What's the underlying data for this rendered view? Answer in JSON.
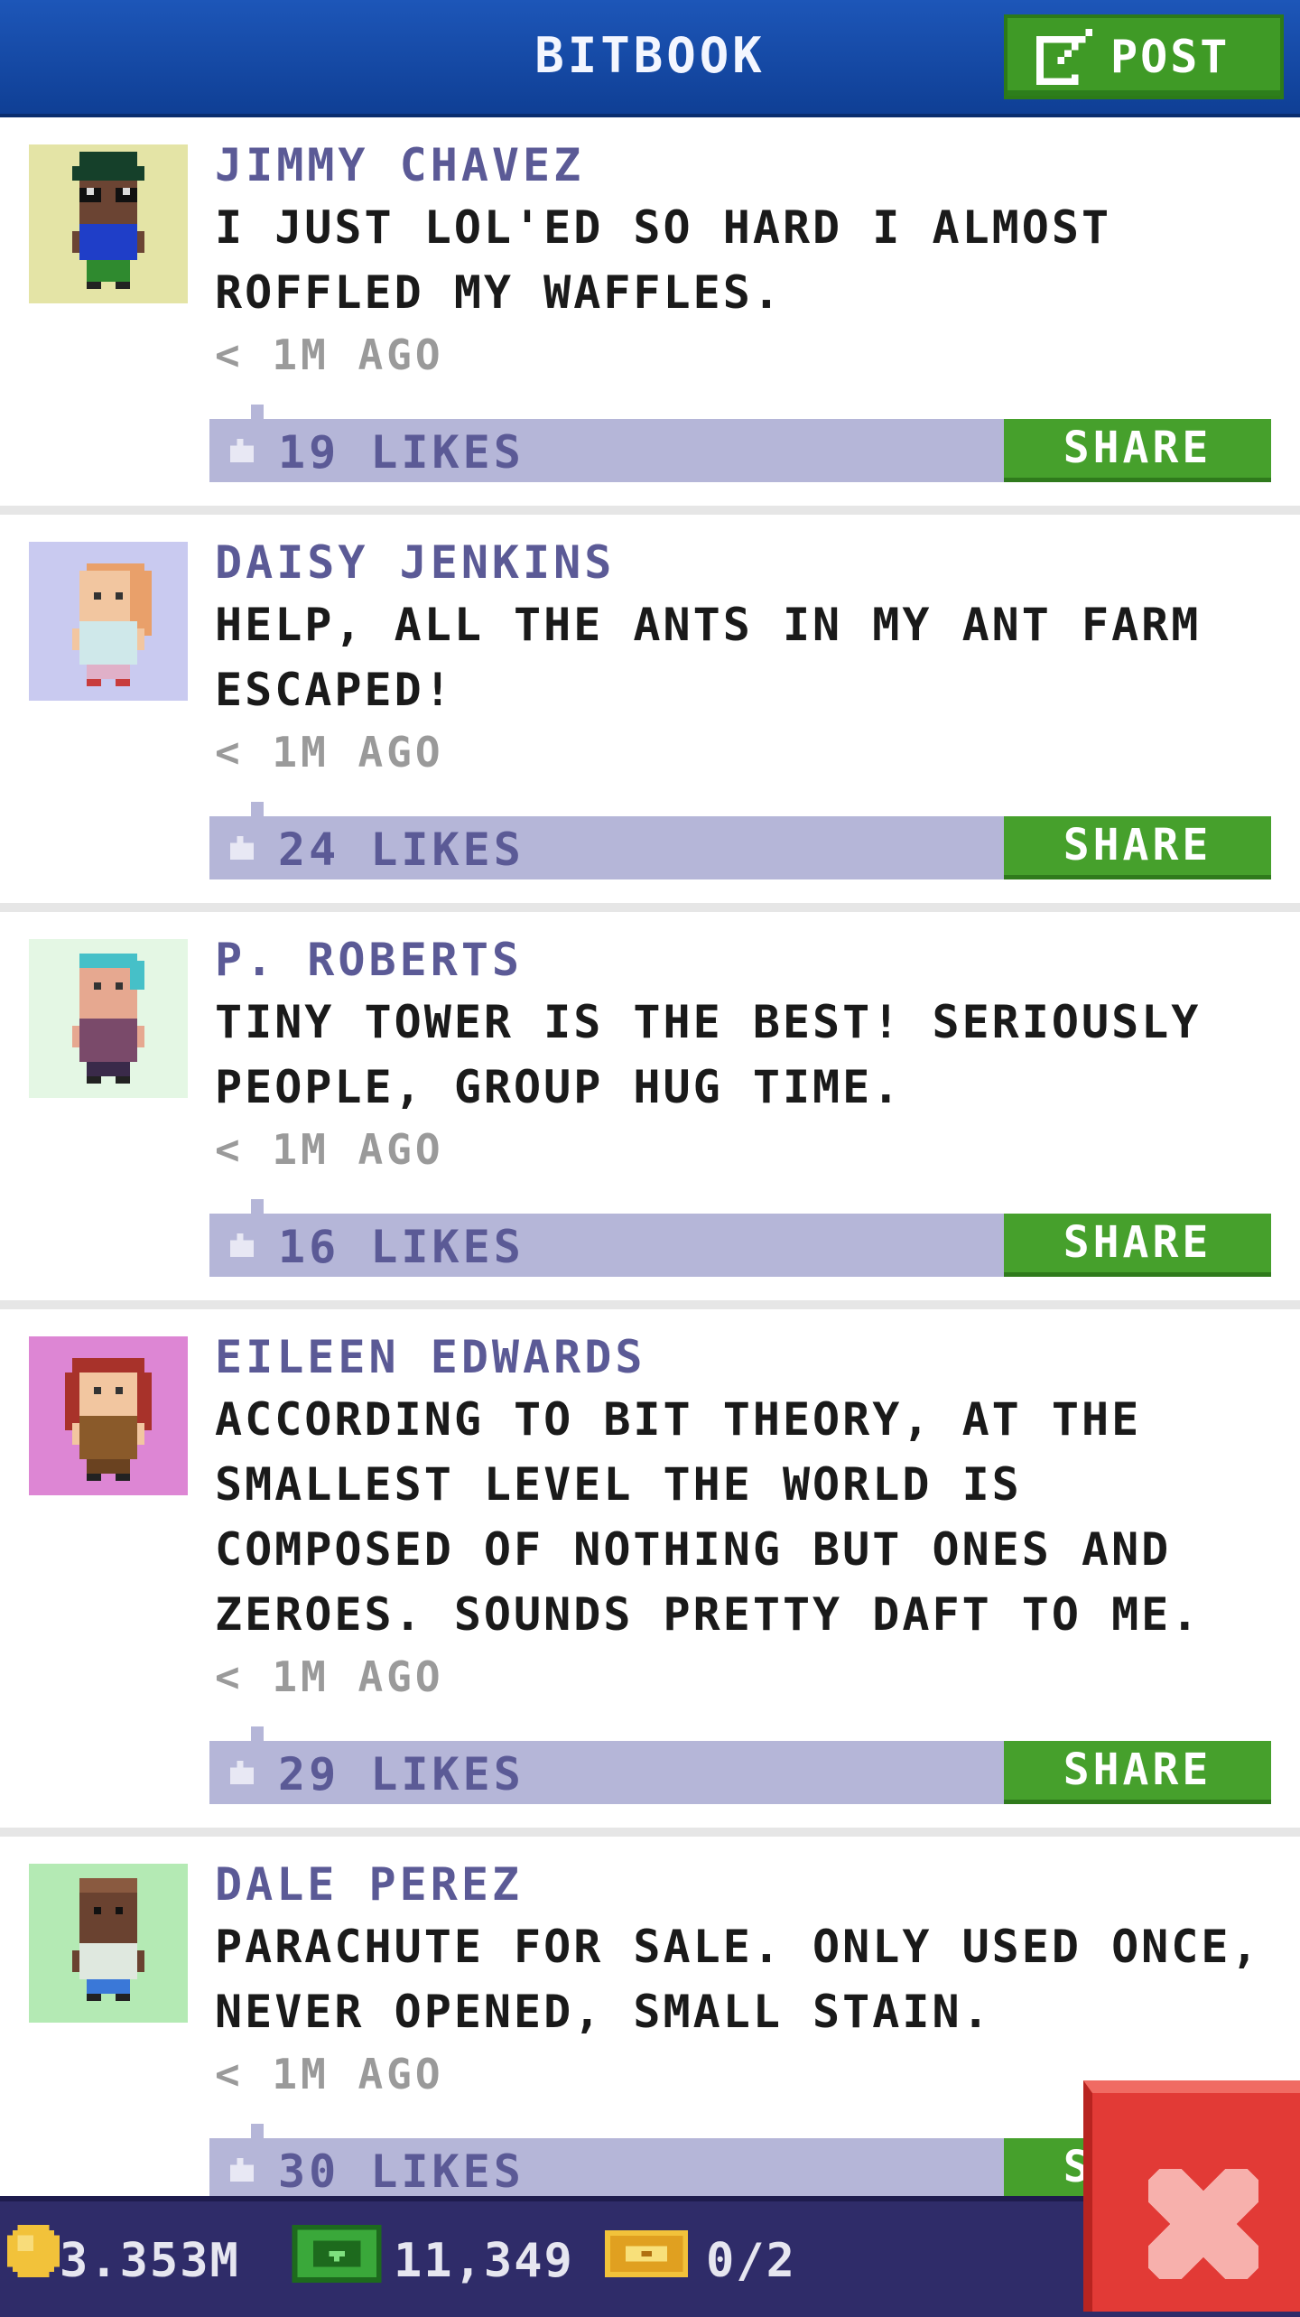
{
  "header": {
    "title": "BITBOOK",
    "post_label": "POST",
    "post_icon": "edit-icon"
  },
  "posts": [
    {
      "name": "JIMMY CHAVEZ",
      "message": "I JUST LOL'ED SO HARD I ALMOST ROFFLED MY WAFFLES.",
      "time": "< 1M AGO",
      "likes": "19 LIKES",
      "share_label": "SHARE",
      "avatar_bg": "#e4e4a6"
    },
    {
      "name": "DAISY JENKINS",
      "message": "HELP, ALL THE ANTS IN MY ANT FARM ESCAPED!",
      "time": "< 1M AGO",
      "likes": "24 LIKES",
      "share_label": "SHARE",
      "avatar_bg": "#c9caf0"
    },
    {
      "name": "P. ROBERTS",
      "message": "TINY TOWER IS THE BEST! SERIOUSLY PEOPLE, GROUP HUG TIME.",
      "time": "< 1M AGO",
      "likes": "16 LIKES",
      "share_label": "SHARE",
      "avatar_bg": "#e4f7e4"
    },
    {
      "name": "EILEEN EDWARDS",
      "message": "ACCORDING TO BIT THEORY, AT THE SMALLEST LEVEL THE WORLD IS COMPOSED OF NOTHING BUT ONES AND ZEROES. SOUNDS PRETTY DAFT TO ME.",
      "time": "< 1M AGO",
      "likes": "29 LIKES",
      "share_label": "SHARE",
      "avatar_bg": "#dd86d4"
    },
    {
      "name": "DALE PEREZ",
      "message": "PARACHUTE FOR SALE. ONLY USED ONCE, NEVER OPENED, SMALL STAIN.",
      "time": "< 1M AGO",
      "likes": "30 LIKES",
      "share_label": "SHARE",
      "avatar_bg": "#b4eab4"
    }
  ],
  "statusbar": {
    "coins": "3.353M",
    "bux": "11,349",
    "tickets": "0/2"
  },
  "colors": {
    "header": "#1d56b8",
    "name": "#5b5a96",
    "likebar": "#b5b6d8",
    "share": "#46a02c",
    "statusbar": "#2f2c69",
    "close": "#e23a36"
  }
}
